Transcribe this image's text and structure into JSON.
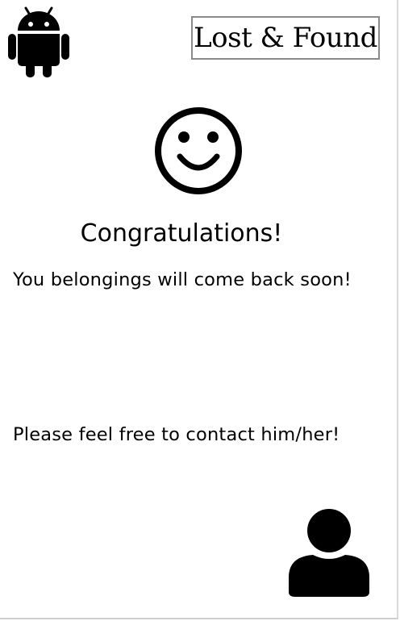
{
  "header": {
    "platform_icon": "android-icon",
    "logo_text": "Lost & Found"
  },
  "main": {
    "status_icon": "smiley-icon",
    "title": "Congratulations!",
    "message": "You belongings will come back soon!",
    "contact_prompt": "Please feel free to contact him/her!",
    "contact_icon": "person-icon"
  }
}
